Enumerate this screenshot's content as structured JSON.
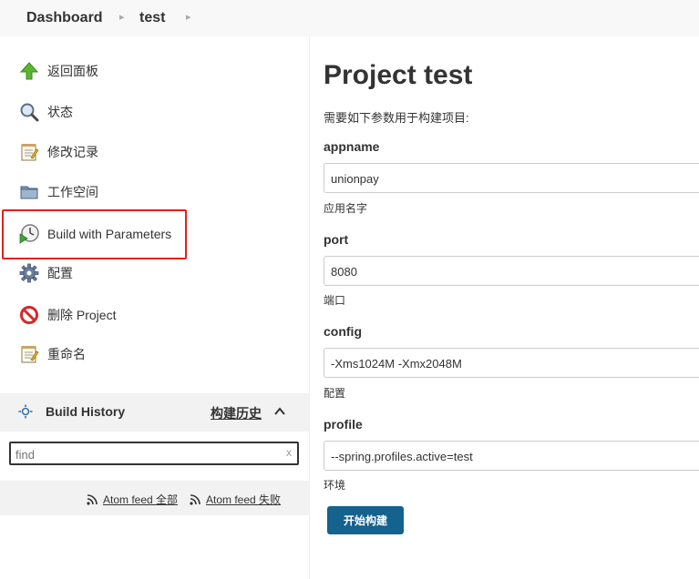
{
  "breadcrumb": [
    {
      "label": "Dashboard"
    },
    {
      "label": "test"
    }
  ],
  "sidebar": {
    "tasks": [
      {
        "label": "返回面板",
        "icon": "up-arrow-icon"
      },
      {
        "label": "状态",
        "icon": "magnifier-icon"
      },
      {
        "label": "修改记录",
        "icon": "notepad-icon"
      },
      {
        "label": "工作空间",
        "icon": "folder-icon"
      },
      {
        "label": "Build with Parameters",
        "icon": "clock-play-icon"
      },
      {
        "label": "配置",
        "icon": "gear-icon"
      },
      {
        "label": "删除 Project",
        "icon": "no-entry-icon"
      },
      {
        "label": "重命名",
        "icon": "notepad-icon"
      }
    ],
    "build_history": {
      "title": "Build History",
      "trend_link": "构建历史",
      "find_placeholder": "find",
      "clear_label": "x"
    },
    "feeds": [
      {
        "label": "Atom feed 全部"
      },
      {
        "label": "Atom feed 失败"
      }
    ]
  },
  "main": {
    "title": "Project test",
    "description": "需要如下参数用于构建项目:",
    "parameters": [
      {
        "name": "appname",
        "value": "unionpay",
        "description": "应用名字"
      },
      {
        "name": "port",
        "value": "8080",
        "description": "端口"
      },
      {
        "name": "config",
        "value": "-Xms1024M -Xmx2048M",
        "description": "配置"
      },
      {
        "name": "profile",
        "value": "--spring.profiles.active=test",
        "description": "环境"
      }
    ],
    "build_button": "开始构建"
  },
  "colors": {
    "accent_button": "#14628e",
    "highlight_border": "#e0221a",
    "panel_bg": "#f2f2f2"
  }
}
